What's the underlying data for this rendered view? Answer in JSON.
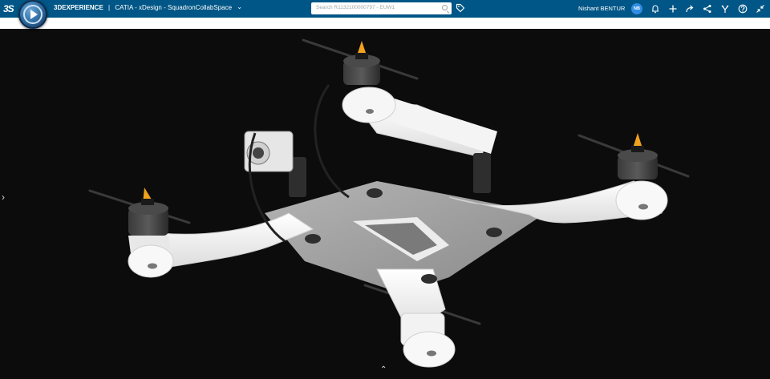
{
  "header": {
    "brand_bold": "3DEXPERIENCE",
    "brand_separator": "|",
    "app_context": "CATIA - xDesign - SquadronCollabSpace",
    "app_logo_text": "3S",
    "search_placeholder": "Search R1132100000797 - EUW1",
    "user_name": "Nishant BENTUR",
    "avatar_initials": "NB",
    "icons": [
      "tag-icon",
      "notification-icon",
      "add-icon",
      "share-icon",
      "network-icon",
      "tools-icon",
      "help-icon",
      "collapse-icon"
    ]
  },
  "viewport": {
    "background": "#0c0c0c",
    "model": "quadcopter-drone-frame",
    "left_panel_toggle": "›",
    "bottom_panel_toggle": "⌃"
  },
  "colors": {
    "topbar": "#005686",
    "frame_white": "#f2f2f2",
    "frame_gray": "#9a9a9a",
    "motor_dark": "#2b2b2b",
    "prop_tip": "#f0a21f",
    "avatar": "#2f8de4"
  }
}
